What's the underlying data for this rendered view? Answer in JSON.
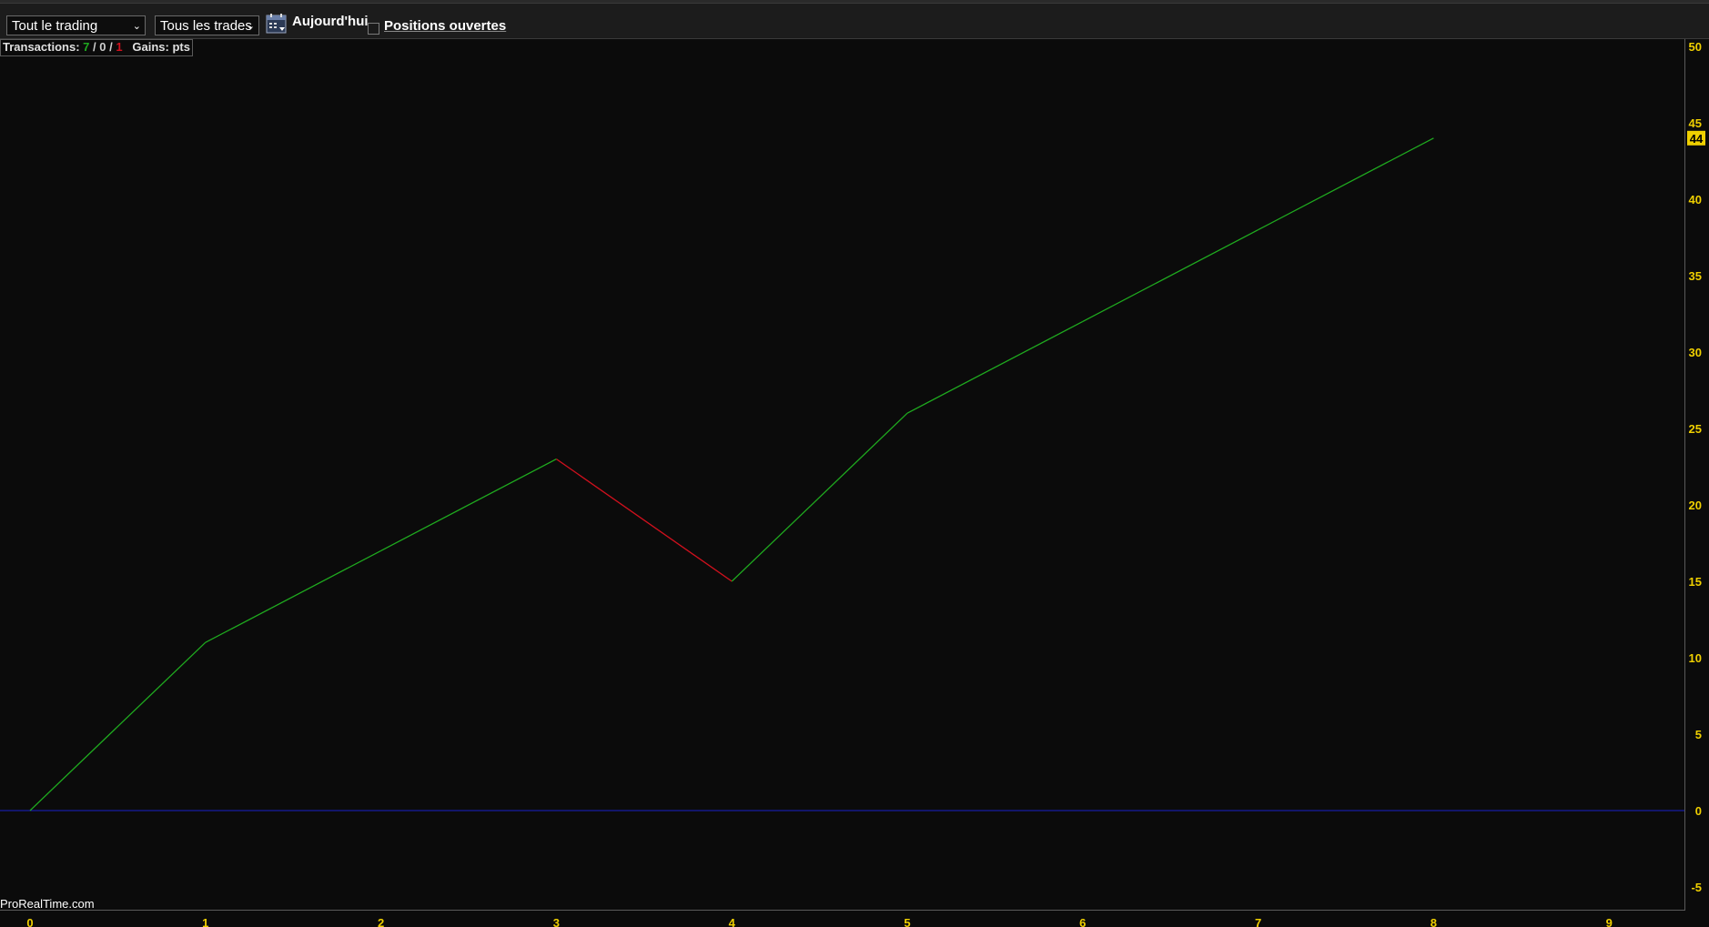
{
  "toolbar": {
    "scope_select": "Tout le trading",
    "trades_select": "Tous les trades",
    "today_label": "Aujourd'hui",
    "open_positions_label": "Positions ouvertes",
    "open_positions_checked": false
  },
  "info": {
    "transactions_label": "Transactions:",
    "wins": "7",
    "sep1": " / ",
    "neutral": "0",
    "sep2": " / ",
    "losses": "1",
    "gains_label": "Gains:",
    "gains_unit": "pts"
  },
  "watermark": "ProRealTime.com",
  "colors": {
    "background": "#0b0b0b",
    "gain_line": "#1faa1f",
    "loss_line": "#d0101d",
    "zero_line": "#1a20c8",
    "ticks": "#f0d000",
    "last_badge_bg": "#f0d000",
    "last_badge_text": "#000000"
  },
  "chart_data": {
    "type": "line",
    "x": [
      0,
      1,
      2,
      3,
      4,
      5,
      6,
      7,
      8
    ],
    "values": [
      0,
      11,
      17,
      23,
      15,
      26,
      32,
      38,
      44
    ],
    "xlim": [
      0,
      9.45
    ],
    "ylim": [
      -6,
      50.5
    ],
    "x_ticks": [
      "0",
      "1",
      "2",
      "3",
      "4",
      "5",
      "6",
      "7",
      "8",
      "9"
    ],
    "y_ticks": [
      "50",
      "45",
      "40",
      "35",
      "30",
      "25",
      "20",
      "15",
      "10",
      "5",
      "0",
      "-5"
    ],
    "y_tick_values": [
      50,
      45,
      40,
      35,
      30,
      25,
      20,
      15,
      10,
      5,
      0,
      -5
    ],
    "last_value_label": "44",
    "baseline": 0,
    "grid": false
  }
}
